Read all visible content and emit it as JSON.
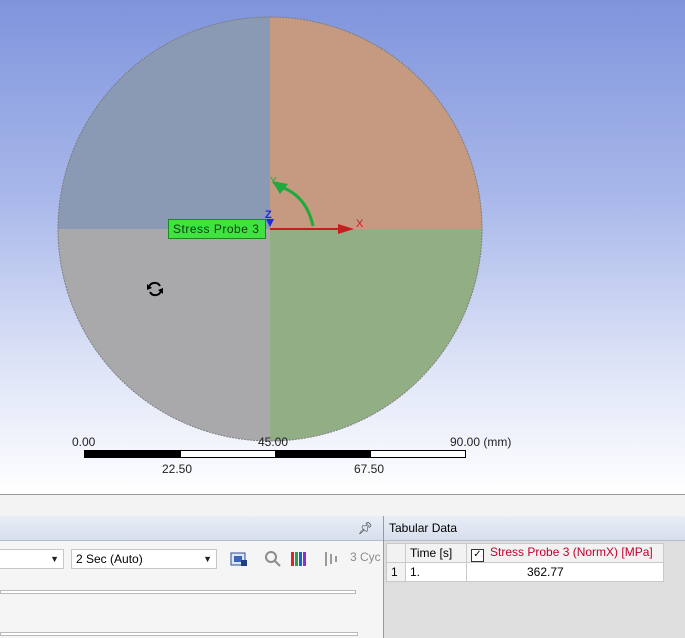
{
  "viewport": {
    "probe_label": "Stress Probe 3",
    "triad": {
      "x_label": "X",
      "y_label": "Y",
      "z_label": "Z"
    },
    "icons": {
      "cursor": "rotate-cursor-icon"
    },
    "scale": {
      "top_labels": [
        "0.00",
        "45.00",
        "90.00 (mm)"
      ],
      "bottom_labels": [
        "22.50",
        "67.50"
      ]
    },
    "colors": {
      "quadrant_top_left": "#8a9ab4",
      "quadrant_top_right": "#c59a80",
      "quadrant_bottom_left": "#a9a9ab",
      "quadrant_bottom_right": "#92ae84",
      "x_axis": "#c41e1e",
      "y_axis": "#1eaa3c",
      "z_axis": "#1e2ad2"
    }
  },
  "graph_panel": {
    "pin_icon": "pin-icon",
    "selects": [
      {
        "value": ""
      },
      {
        "value": "2 Sec (Auto)"
      }
    ],
    "toolbar_icons": [
      "export-video-icon",
      "zoom-icon",
      "color-bars-icon",
      "animation-cycles-icon"
    ],
    "cycles_label": "3 Cyc"
  },
  "tabular_data": {
    "title": "Tabular Data",
    "columns": [
      "Time [s]",
      "Stress Probe 3 (NormX) [MPa]"
    ],
    "rows": [
      {
        "index": "1",
        "time": "1.",
        "value": "362.77"
      }
    ],
    "checkbox_checked": true
  }
}
